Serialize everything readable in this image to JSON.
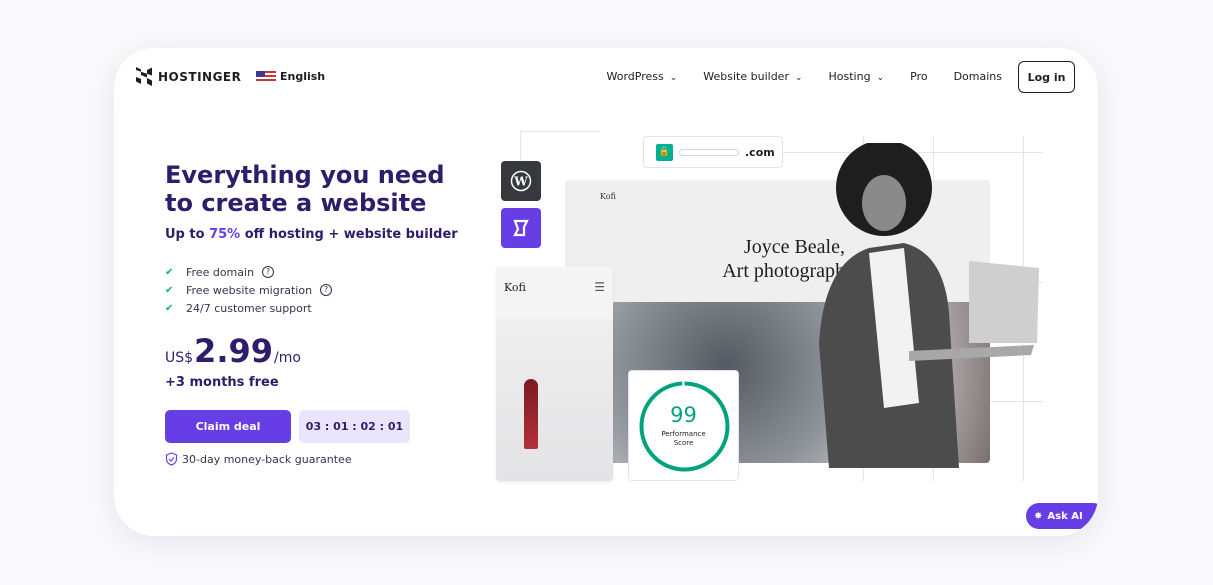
{
  "brand": {
    "name": "HOSTINGER",
    "language": "English"
  },
  "nav": {
    "items": [
      {
        "label": "WordPress",
        "dropdown": true
      },
      {
        "label": "Website builder",
        "dropdown": true
      },
      {
        "label": "Hosting",
        "dropdown": true
      },
      {
        "label": "Pro",
        "dropdown": false
      },
      {
        "label": "Domains",
        "dropdown": false
      }
    ],
    "login": "Log in"
  },
  "hero": {
    "title": "Everything you need to create a website",
    "subtitle_pre": "Up to ",
    "subtitle_highlight": "75%",
    "subtitle_post": " off hosting + website builder",
    "features": [
      "Free domain",
      "Free website migration",
      "24/7 customer support"
    ],
    "price": {
      "currency": "US$",
      "amount": "2.99",
      "period": "/mo"
    },
    "bonus": "+3 months free",
    "cta": "Claim deal",
    "timer": "03 : 01 : 02 : 01",
    "guarantee": "30-day money-back guarantee"
  },
  "illustration": {
    "url_suffix": ".com",
    "site_name": "Kofi",
    "headline_1": "Joyce Beale,",
    "headline_2": "Art photograph",
    "score": "99",
    "score_label_1": "Performance",
    "score_label_2": "Score",
    "score_fraction": 0.99
  },
  "chat": {
    "label": "Ask AI"
  },
  "colors": {
    "primary": "#673de6",
    "heading": "#2f1c6a",
    "success": "#00b090"
  }
}
